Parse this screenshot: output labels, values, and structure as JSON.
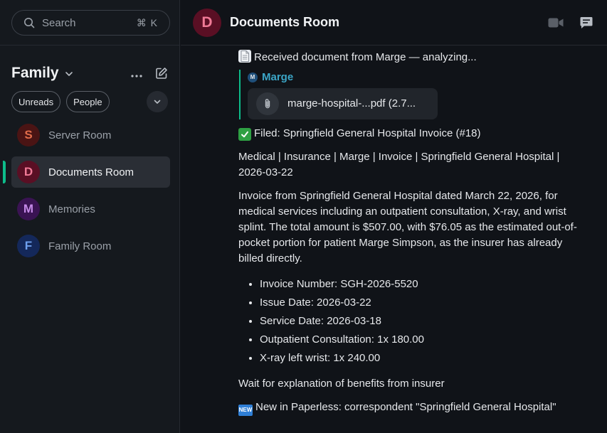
{
  "search": {
    "placeholder": "Search",
    "shortcut": "⌘ K"
  },
  "space": {
    "name": "Family"
  },
  "filters": [
    {
      "label": "Unreads"
    },
    {
      "label": "People"
    }
  ],
  "rooms": [
    {
      "initial": "S",
      "name": "Server Room",
      "avatar_bg": "#4a1414",
      "avatar_fg": "#e06c4a",
      "active": false
    },
    {
      "initial": "D",
      "name": "Documents Room",
      "avatar_bg": "#5a0f24",
      "avatar_fg": "#f07a96",
      "active": true
    },
    {
      "initial": "M",
      "name": "Memories",
      "avatar_bg": "#3a1353",
      "avatar_fg": "#c58ae8",
      "active": false
    },
    {
      "initial": "F",
      "name": "Family Room",
      "avatar_bg": "#14285a",
      "avatar_fg": "#6ea0ee",
      "active": false
    }
  ],
  "header": {
    "initial": "D",
    "title": "Documents Room",
    "avatar_bg": "#5a0f24",
    "avatar_fg": "#f07a96"
  },
  "timeline": {
    "received": "Received document from Marge — analyzing...",
    "quote_sender": "Marge",
    "quote_sender_initial": "M",
    "file_name": "marge-hospital-...pdf (2.7...",
    "filed": "Filed: Springfield General Hospital Invoice (#18)",
    "tags": "Medical | Insurance | Marge | Invoice | Springfield General Hospital | 2026-03-22",
    "summary": "Invoice from Springfield General Hospital dated March 22, 2026, for medical services including an outpatient consultation, X-ray, and wrist splint. The total amount is $507.00, with $76.05 as the estimated out-of-pocket portion for patient Marge Simpson, as the insurer has already billed directly.",
    "items": [
      "Invoice Number: SGH-2026-5520",
      "Issue Date: 2026-03-22",
      "Service Date: 2026-03-18",
      "Outpatient Consultation: 1x 180.00",
      "X-ray left wrist: 1x 240.00"
    ],
    "note": "Wait for explanation of benefits from insurer",
    "new_badge": "NEW",
    "new_text": "New in Paperless: correspondent \"Springfield General Hospital\""
  },
  "colors": {
    "accent": "#0dbd8b",
    "sender": "#3ba6c7"
  },
  "icons": [
    "search-icon",
    "chevron-down-icon",
    "more-icon",
    "compose-icon",
    "video-call-icon",
    "threads-icon",
    "attachment-icon",
    "document-icon",
    "check-icon",
    "new-icon"
  ]
}
